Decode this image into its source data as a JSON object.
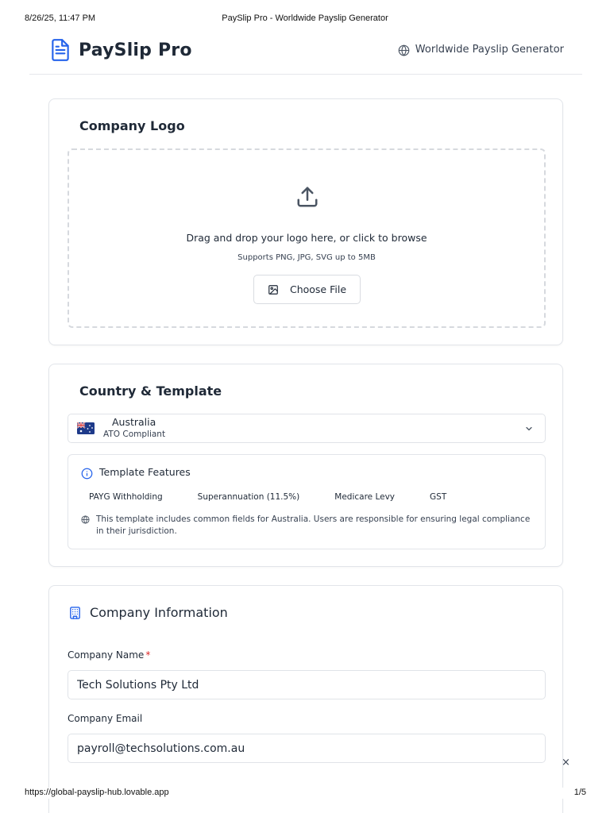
{
  "print_header": {
    "datetime": "8/26/25, 11:47 PM",
    "page_title": "PaySlip Pro - Worldwide Payslip Generator"
  },
  "header": {
    "brand_name": "PaySlip Pro",
    "tagline": "Worldwide Payslip Generator",
    "brand_color": "#2563eb",
    "icons": [
      "document-icon",
      "globe-icon"
    ]
  },
  "logo_section": {
    "title": "Company Logo",
    "dropzone_text": "Drag and drop your logo here, or click to browse",
    "dropzone_hint": "Supports PNG, JPG, SVG up to 5MB",
    "choose_button": "Choose File"
  },
  "country_section": {
    "title": "Country & Template",
    "selected_country": "Australia",
    "selected_country_sub": "ATO Compliant",
    "features_title": "Template Features",
    "features": [
      "PAYG Withholding",
      "Superannuation (11.5%)",
      "Medicare Levy",
      "GST"
    ],
    "note": "This template includes common fields for Australia. Users are responsible for ensuring legal compliance in their jurisdiction."
  },
  "company_section": {
    "title": "Company Information",
    "company_name_label": "Company Name",
    "company_name_required": "*",
    "company_name_value": "Tech Solutions Pty Ltd",
    "company_email_label": "Company Email",
    "company_email_value": "payroll@techsolutions.com.au"
  },
  "close_glyph": "×",
  "print_footer": {
    "url": "https://global-payslip-hub.lovable.app",
    "page": "1/5"
  }
}
